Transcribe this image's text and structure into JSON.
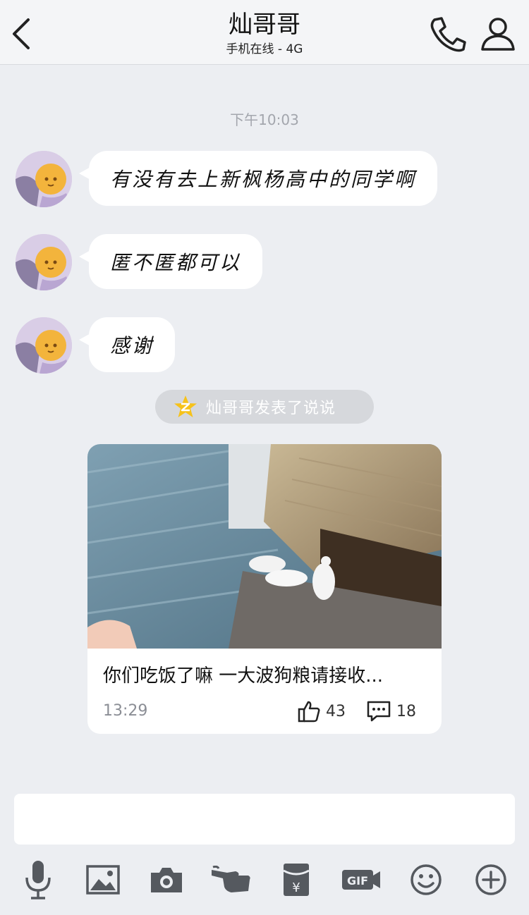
{
  "header": {
    "title": "灿哥哥",
    "subtitle": "手机在线 - 4G",
    "icons": [
      "back-chevron-icon",
      "phone-icon",
      "profile-icon"
    ]
  },
  "chat": {
    "timestamp": "下午10:03",
    "messages": [
      {
        "text": "有没有去上新枫杨高中的同学啊"
      },
      {
        "text": "匿不匿都可以"
      },
      {
        "text": "感谢"
      }
    ]
  },
  "notice": {
    "text": "灿哥哥发表了说说",
    "icon": "qzone-star-icon"
  },
  "post": {
    "text": "你们吃饭了嘛 一大波狗粮请接收...",
    "time": "13:29",
    "likes": "43",
    "comments": "18"
  },
  "input": {
    "value": "",
    "placeholder": ""
  },
  "toolbar": {
    "items": [
      "microphone-icon",
      "image-icon",
      "camera-icon",
      "poke-hand-icon",
      "red-packet-icon",
      "gif-icon",
      "emoji-icon",
      "plus-icon"
    ]
  },
  "colors": {
    "background": "#eceef2",
    "header": "#f4f5f7",
    "bubble": "#ffffff",
    "notice": "#d6d8dc",
    "icon": "#222222"
  }
}
